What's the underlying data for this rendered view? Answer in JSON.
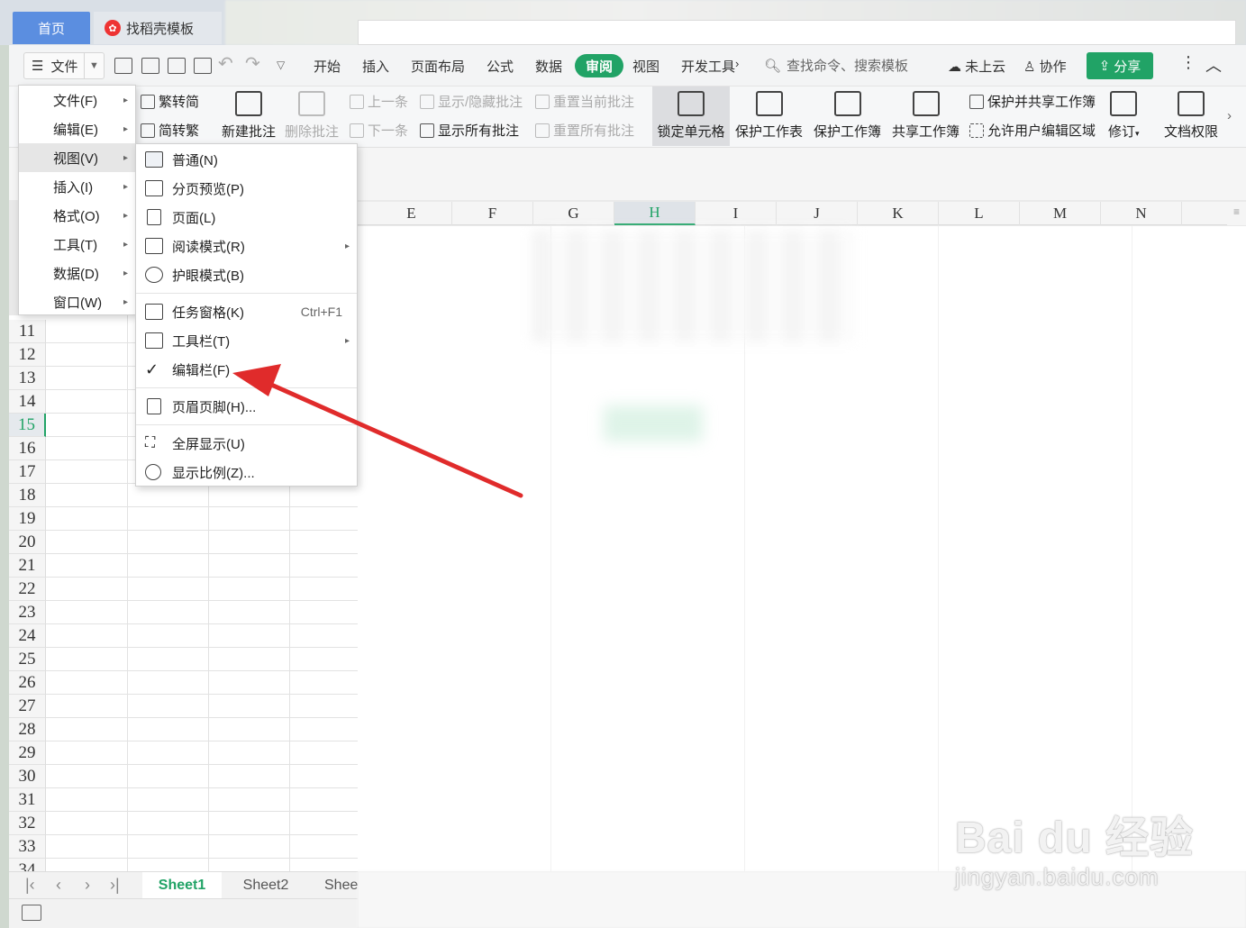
{
  "tabs": {
    "home": "首页",
    "template": "找稻壳模板"
  },
  "menubar": {
    "file_label": "文件",
    "items": [
      "开始",
      "插入",
      "页面布局",
      "公式",
      "数据",
      "审阅",
      "视图",
      "开发工具"
    ],
    "active_tab": "审阅",
    "search_placeholder": "查找命令、搜索模板",
    "cloud": "未上云",
    "collab": "协作",
    "share": "分享"
  },
  "ribbon": {
    "trad_simp": "繁转简",
    "simp_trad": "简转繁",
    "new_comment": "新建批注",
    "delete_comment": "删除批注",
    "prev": "上一条",
    "next": "下一条",
    "show_hide_comment": "显示/隐藏批注",
    "show_all_comments": "显示所有批注",
    "reset_current": "重置当前批注",
    "reset_all": "重置所有批注",
    "lock_cells": "锁定单元格",
    "protect_sheet": "保护工作表",
    "protect_workbook": "保护工作簿",
    "share_workbook": "共享工作簿",
    "protect_share": "保护并共享工作簿",
    "allow_edit": "允许用户编辑区域",
    "revise": "修订",
    "doc_permission": "文档权限"
  },
  "columns": [
    "E",
    "F",
    "G",
    "H",
    "I",
    "J",
    "K",
    "L",
    "M",
    "N"
  ],
  "selected_column": "H",
  "rows": [
    "11",
    "12",
    "13",
    "14",
    "15",
    "16",
    "17",
    "18",
    "19",
    "20",
    "21",
    "22",
    "23",
    "24",
    "25",
    "26",
    "27",
    "28",
    "29",
    "30",
    "31",
    "32",
    "33",
    "34"
  ],
  "selected_row": "15",
  "menu_main": [
    {
      "label": "文件(F)"
    },
    {
      "label": "编辑(E)"
    },
    {
      "label": "视图(V)"
    },
    {
      "label": "插入(I)"
    },
    {
      "label": "格式(O)"
    },
    {
      "label": "工具(T)"
    },
    {
      "label": "数据(D)"
    },
    {
      "label": "窗口(W)"
    }
  ],
  "menu_view": {
    "normal": "普通(N)",
    "page_break": "分页预览(P)",
    "page": "页面(L)",
    "reading": "阅读模式(R)",
    "eye_care": "护眼模式(B)",
    "task_pane": "任务窗格(K)",
    "task_pane_shortcut": "Ctrl+F1",
    "toolbar": "工具栏(T)",
    "formula_bar": "编辑栏(F)",
    "header_footer": "页眉页脚(H)...",
    "fullscreen": "全屏显示(U)",
    "zoom": "显示比例(Z)..."
  },
  "sheets": [
    "Sheet1",
    "Sheet2",
    "Shee"
  ],
  "active_sheet": "Sheet1",
  "watermark": {
    "main": "Bai du 经验",
    "sub": "jingyan.baidu.com"
  },
  "colors": {
    "accent": "#21a366",
    "home_tab": "#5b8ee0",
    "arrow": "#e02b2b"
  }
}
